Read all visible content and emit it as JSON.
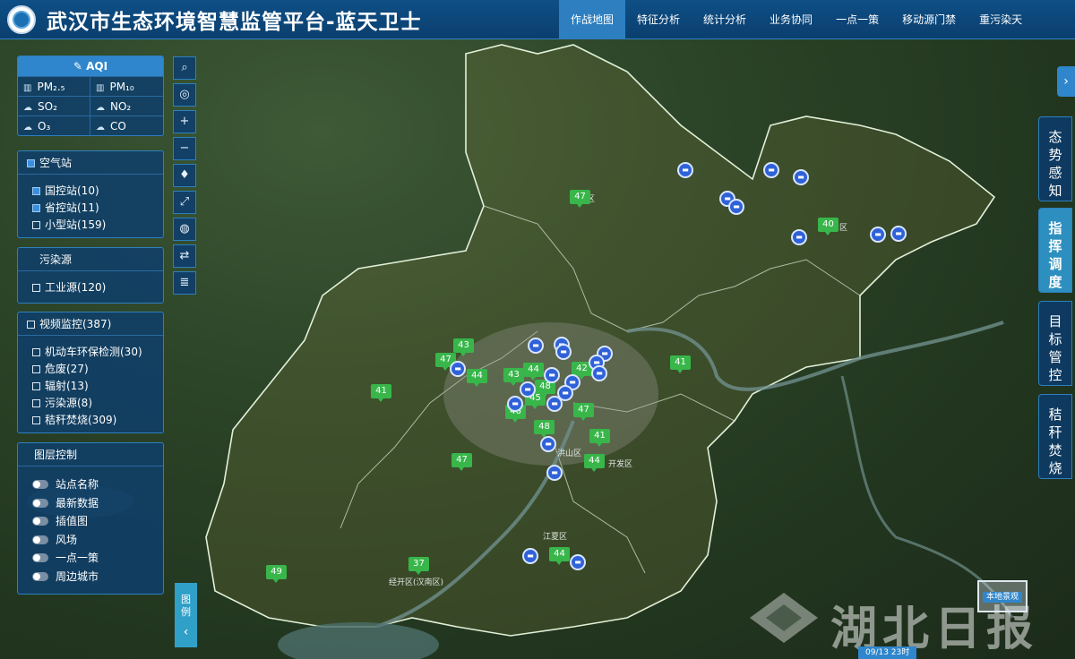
{
  "header": {
    "title": "武汉市生态环境智慧监管平台-蓝天卫士",
    "nav": [
      "作战地图",
      "特征分析",
      "统计分析",
      "业务协同",
      "一点一策",
      "移动源门禁",
      "重污染天"
    ]
  },
  "aqi_panel": {
    "title": "AQI",
    "pollutants": [
      "PM₂.₅",
      "PM₁₀",
      "SO₂",
      "NO₂",
      "O₃",
      "CO"
    ]
  },
  "station_panel": {
    "title": "空气站",
    "items": [
      {
        "label": "国控站(10)",
        "checked": true
      },
      {
        "label": "省控站(11)",
        "checked": true
      },
      {
        "label": "小型站(159)",
        "checked": false
      }
    ]
  },
  "source_panel": {
    "title": "污染源",
    "items": [
      {
        "label": "工业源(120)",
        "checked": false
      }
    ]
  },
  "video_panel": {
    "title": "视频监控(387)",
    "items": [
      {
        "label": "机动车环保检测(30)"
      },
      {
        "label": "危废(27)"
      },
      {
        "label": "辐射(13)"
      },
      {
        "label": "污染源(8)"
      },
      {
        "label": "秸秆焚烧(309)"
      }
    ]
  },
  "layer_panel": {
    "title": "图层控制",
    "items": [
      "站点名称",
      "最新数据",
      "插值图",
      "风场",
      "一点一策",
      "周边城市"
    ]
  },
  "tools": [
    "search-icon",
    "locate-icon",
    "zoom-in-icon",
    "zoom-out-icon",
    "compass-icon",
    "fullscreen-icon",
    "layer-switch-icon",
    "swap-icon",
    "stack-icon"
  ],
  "legend_tab": {
    "label": "图例",
    "arrow": "‹"
  },
  "right_tabs": [
    "态势感知",
    "指挥调度",
    "目标管控",
    "秸秆焚烧"
  ],
  "right_arrow": "›",
  "aqi_markers": [
    {
      "value": "47"
    },
    {
      "value": "40"
    },
    {
      "value": "43"
    },
    {
      "value": "47"
    },
    {
      "value": "44"
    },
    {
      "value": "43"
    },
    {
      "value": "44"
    },
    {
      "value": "42"
    },
    {
      "value": "41"
    },
    {
      "value": "41"
    },
    {
      "value": "48"
    },
    {
      "value": "45"
    },
    {
      "value": "46"
    },
    {
      "value": "47"
    },
    {
      "value": "48"
    },
    {
      "value": "41"
    },
    {
      "value": "44"
    },
    {
      "value": "47"
    },
    {
      "value": "37"
    },
    {
      "value": "44"
    },
    {
      "value": "49"
    }
  ],
  "place_labels": [
    "区",
    "区",
    "开发区",
    "江夏区",
    "经开区(汉南区)",
    "洪山区"
  ],
  "time_badge": "09/13 23时",
  "local_button": "本地景观",
  "watermark": "湖北日报",
  "colors": {
    "header": "#0e4f86",
    "active_nav": "#2d7fc0",
    "aqi_good": "#38b64a",
    "pin": "#2f62d8"
  }
}
